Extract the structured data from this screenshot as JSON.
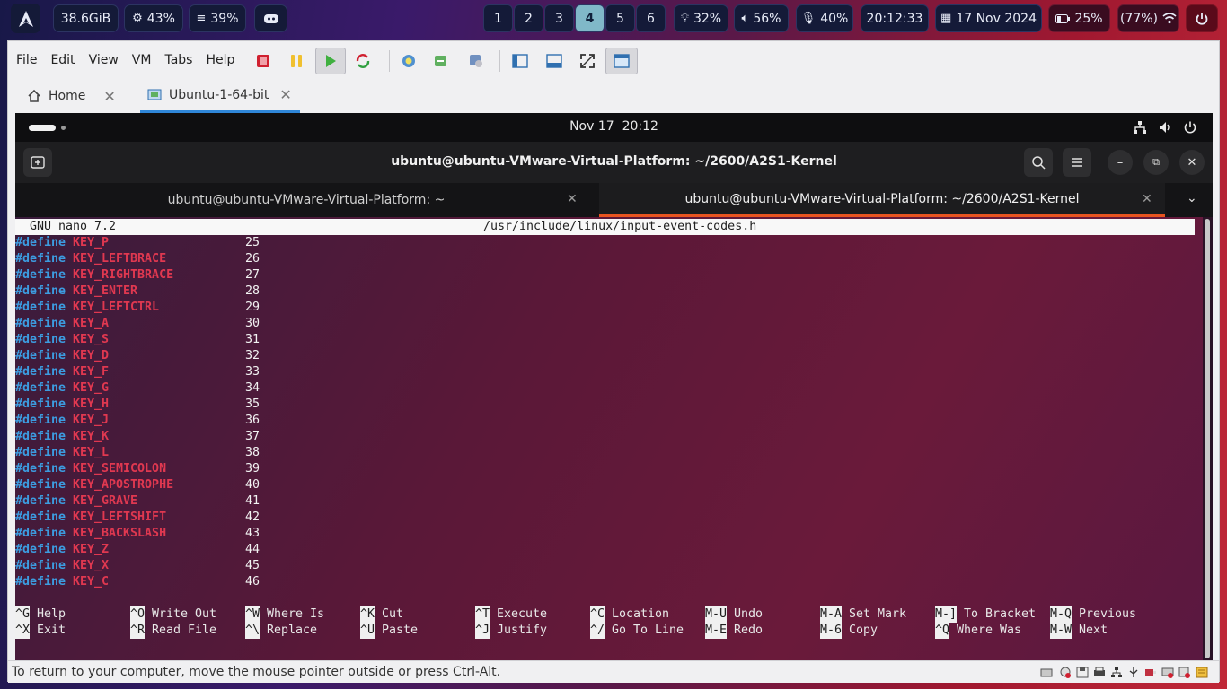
{
  "panel": {
    "memory": "38.6GiB",
    "cpu": "43%",
    "mem_percent": "39%",
    "workspaces": [
      "1",
      "2",
      "3",
      "4",
      "5",
      "6"
    ],
    "active_workspace": "4",
    "brightness": "32%",
    "volume": "56%",
    "mic": "40%",
    "time": "20:12:33",
    "date": "17 Nov 2024",
    "battery": "25%",
    "wifi": "(77%)"
  },
  "vmware": {
    "menu": [
      "File",
      "Edit",
      "View",
      "VM",
      "Tabs",
      "Help"
    ],
    "tabs": [
      {
        "label": "Home"
      },
      {
        "label": "Ubuntu-1-64-bit"
      }
    ],
    "status_text": "To return to your computer, move the mouse pointer outside or press Ctrl-Alt."
  },
  "gnome": {
    "clock": "Nov 17  20:12"
  },
  "terminal": {
    "title": "ubuntu@ubuntu-VMware-Virtual-Platform: ~/2600/A2S1-Kernel",
    "tabs": [
      {
        "label": "ubuntu@ubuntu-VMware-Virtual-Platform: ~"
      },
      {
        "label": "ubuntu@ubuntu-VMware-Virtual-Platform: ~/2600/A2S1-Kernel"
      }
    ]
  },
  "nano": {
    "version": "GNU nano 7.2",
    "file": "/usr/include/linux/input-event-codes.h",
    "lines": [
      {
        "kw": "#define",
        "name": "KEY_P",
        "val": "25"
      },
      {
        "kw": "#define",
        "name": "KEY_LEFTBRACE",
        "val": "26"
      },
      {
        "kw": "#define",
        "name": "KEY_RIGHTBRACE",
        "val": "27"
      },
      {
        "kw": "#define",
        "name": "KEY_ENTER",
        "val": "28"
      },
      {
        "kw": "#define",
        "name": "KEY_LEFTCTRL",
        "val": "29"
      },
      {
        "kw": "#define",
        "name": "KEY_A",
        "val": "30"
      },
      {
        "kw": "#define",
        "name": "KEY_S",
        "val": "31"
      },
      {
        "kw": "#define",
        "name": "KEY_D",
        "val": "32"
      },
      {
        "kw": "#define",
        "name": "KEY_F",
        "val": "33"
      },
      {
        "kw": "#define",
        "name": "KEY_G",
        "val": "34"
      },
      {
        "kw": "#define",
        "name": "KEY_H",
        "val": "35"
      },
      {
        "kw": "#define",
        "name": "KEY_J",
        "val": "36"
      },
      {
        "kw": "#define",
        "name": "KEY_K",
        "val": "37"
      },
      {
        "kw": "#define",
        "name": "KEY_L",
        "val": "38"
      },
      {
        "kw": "#define",
        "name": "KEY_SEMICOLON",
        "val": "39"
      },
      {
        "kw": "#define",
        "name": "KEY_APOSTROPHE",
        "val": "40"
      },
      {
        "kw": "#define",
        "name": "KEY_GRAVE",
        "val": "41"
      },
      {
        "kw": "#define",
        "name": "KEY_LEFTSHIFT",
        "val": "42"
      },
      {
        "kw": "#define",
        "name": "KEY_BACKSLASH",
        "val": "43"
      },
      {
        "kw": "#define",
        "name": "KEY_Z",
        "val": "44"
      },
      {
        "kw": "#define",
        "name": "KEY_X",
        "val": "45"
      },
      {
        "kw": "#define",
        "name": "KEY_C",
        "val": "46"
      }
    ],
    "shortcuts_row1": [
      {
        "key": "^G",
        "label": "Help"
      },
      {
        "key": "^O",
        "label": "Write Out"
      },
      {
        "key": "^W",
        "label": "Where Is"
      },
      {
        "key": "^K",
        "label": "Cut"
      },
      {
        "key": "^T",
        "label": "Execute"
      },
      {
        "key": "^C",
        "label": "Location"
      },
      {
        "key": "M-U",
        "label": "Undo"
      },
      {
        "key": "M-A",
        "label": "Set Mark"
      },
      {
        "key": "M-]",
        "label": "To Bracket"
      },
      {
        "key": "M-Q",
        "label": "Previous"
      }
    ],
    "shortcuts_row2": [
      {
        "key": "^X",
        "label": "Exit"
      },
      {
        "key": "^R",
        "label": "Read File"
      },
      {
        "key": "^\\",
        "label": "Replace"
      },
      {
        "key": "^U",
        "label": "Paste"
      },
      {
        "key": "^J",
        "label": "Justify"
      },
      {
        "key": "^/",
        "label": "Go To Line"
      },
      {
        "key": "M-E",
        "label": "Redo"
      },
      {
        "key": "M-6",
        "label": "Copy"
      },
      {
        "key": "^Q",
        "label": "Where Was"
      },
      {
        "key": "M-W",
        "label": "Next"
      }
    ]
  }
}
